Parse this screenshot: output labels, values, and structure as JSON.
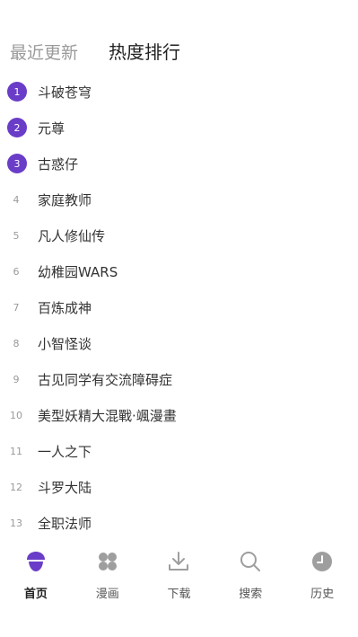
{
  "tabs": {
    "recent_label": "最近更新",
    "hot_label": "热度排行"
  },
  "ranking": [
    {
      "rank": "1",
      "title": "斗破苍穹",
      "highlight": true
    },
    {
      "rank": "2",
      "title": "元尊",
      "highlight": true
    },
    {
      "rank": "3",
      "title": "古惑仔",
      "highlight": true
    },
    {
      "rank": "4",
      "title": "家庭教师",
      "highlight": false
    },
    {
      "rank": "5",
      "title": "凡人修仙传",
      "highlight": false
    },
    {
      "rank": "6",
      "title": "幼稚园WARS",
      "highlight": false
    },
    {
      "rank": "7",
      "title": "百炼成神",
      "highlight": false
    },
    {
      "rank": "8",
      "title": "小智怪谈",
      "highlight": false
    },
    {
      "rank": "9",
      "title": "古见同学有交流障碍症",
      "highlight": false
    },
    {
      "rank": "10",
      "title": "美型妖精大混戰·颯漫畫",
      "highlight": false
    },
    {
      "rank": "11",
      "title": "一人之下",
      "highlight": false
    },
    {
      "rank": "12",
      "title": "斗罗大陆",
      "highlight": false
    },
    {
      "rank": "13",
      "title": "全职法师",
      "highlight": false
    }
  ],
  "nav": {
    "home_label": "首页",
    "comics_label": "漫画",
    "download_label": "下载",
    "search_label": "搜索",
    "history_label": "历史"
  },
  "colors": {
    "accent": "#6a3dc8",
    "icon_gray": "#9e9e9e"
  }
}
